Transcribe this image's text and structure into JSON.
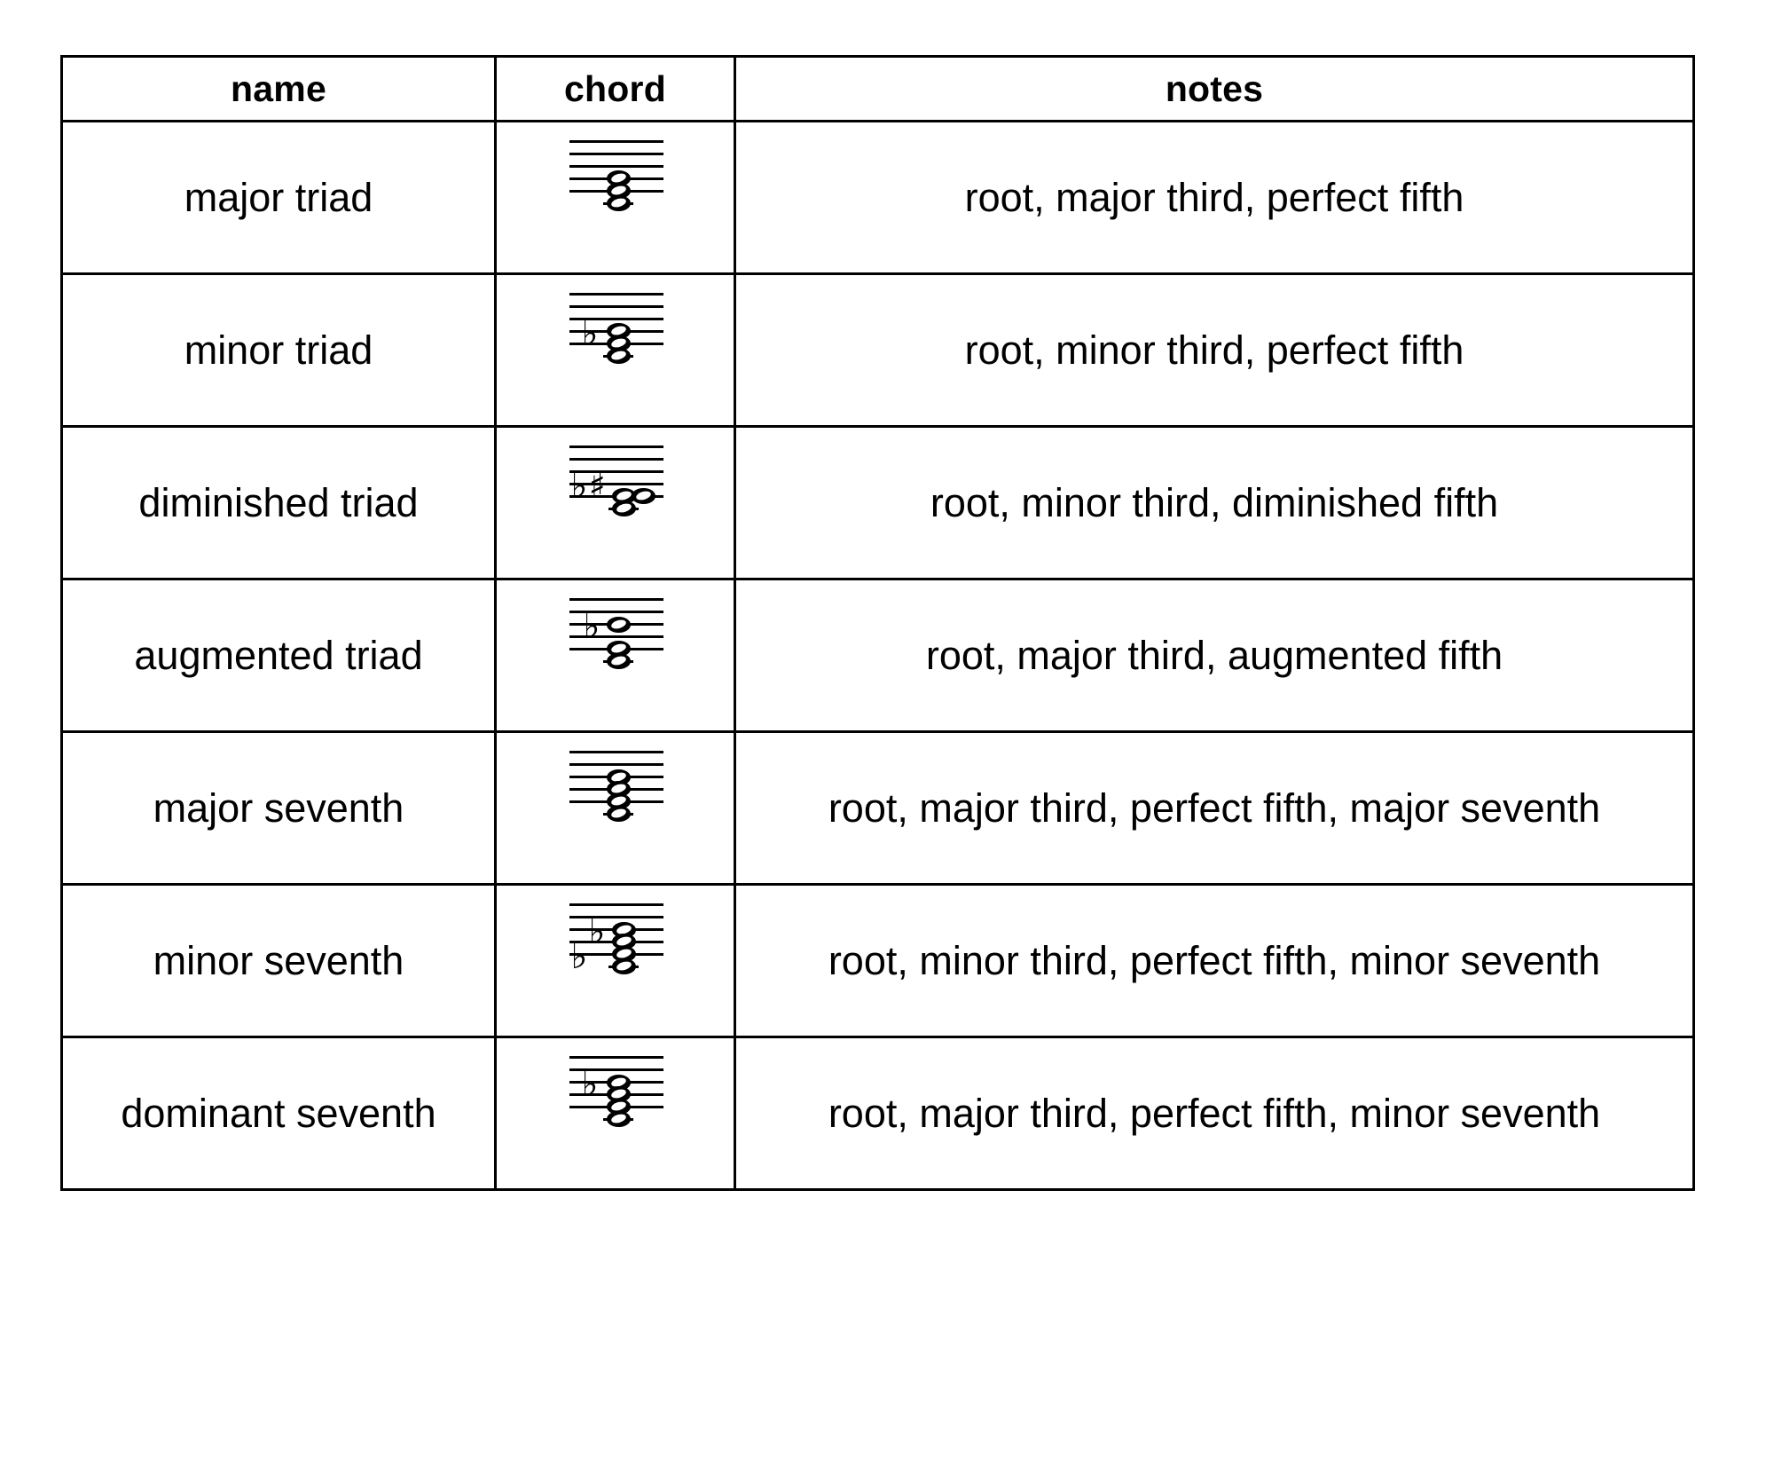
{
  "table": {
    "headers": {
      "name": "name",
      "chord": "chord",
      "notes": "notes"
    },
    "rows": [
      {
        "name": "major triad",
        "notes": "root, major third, perfect fifth",
        "chord_alt": "three stacked whole notes on the lower staff lines, no accidentals",
        "notehead_count": "3",
        "accidentals": ""
      },
      {
        "name": "minor triad",
        "notes": "root, minor third, perfect fifth",
        "chord_alt": "three stacked whole notes with one flat on the middle note",
        "notehead_count": "3",
        "accidentals": "♭"
      },
      {
        "name": "diminished triad",
        "notes": "root, minor third, diminished fifth",
        "chord_alt": "three stacked whole notes with a flat and a sharp accidental",
        "notehead_count": "3",
        "accidentals": "♭ ♯"
      },
      {
        "name": "augmented triad",
        "notes": "root, major third, augmented fifth",
        "chord_alt": "three stacked whole notes with a flat on the top note",
        "notehead_count": "3",
        "accidentals": "♭"
      },
      {
        "name": "major seventh",
        "notes": "root, major third, perfect fifth, major seventh",
        "chord_alt": "four stacked whole notes, no accidentals",
        "notehead_count": "4",
        "accidentals": ""
      },
      {
        "name": "minor seventh",
        "notes": "root, minor third, perfect fifth, minor seventh",
        "chord_alt": "four stacked whole notes with two flats",
        "notehead_count": "4",
        "accidentals": "♭ ♭"
      },
      {
        "name": "dominant seventh",
        "notes": "root, major third, perfect fifth, minor seventh",
        "chord_alt": "four stacked whole notes with one flat on the top note",
        "notehead_count": "4",
        "accidentals": "♭"
      }
    ]
  },
  "colors": {
    "ink": "#000000",
    "paper": "#ffffff"
  }
}
